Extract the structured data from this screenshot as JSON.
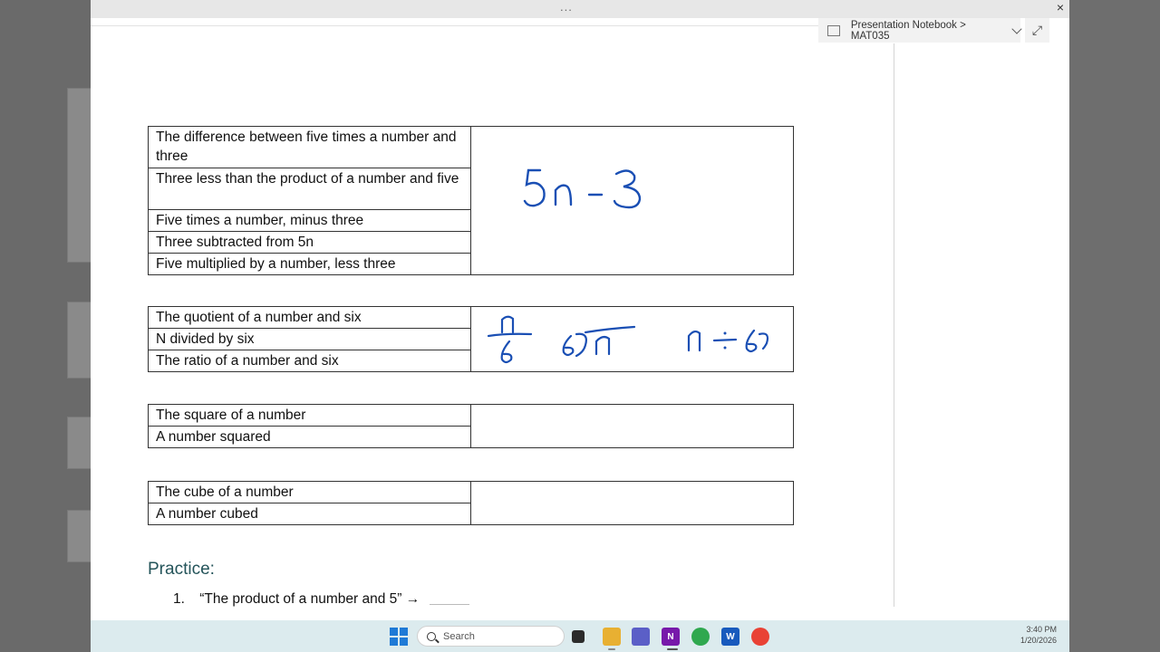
{
  "window": {
    "breadcrumb": "Presentation Notebook > MAT035",
    "dots": "...",
    "close_label": "×",
    "expand_label": "⤢"
  },
  "tables": [
    {
      "rows": [
        "The difference between five times a number and three",
        "Three less than the product of a number and five",
        "Five times a number, minus three",
        "Three subtracted from 5n",
        "Five multiplied by a number, less three"
      ],
      "ink": "5n − 3"
    },
    {
      "rows": [
        "The quotient of a number and six",
        "N divided by six",
        "The ratio of a number and six"
      ],
      "ink": "n/6   6⟌n   n ÷ 6"
    },
    {
      "rows": [
        "The square of a number",
        "A number squared"
      ],
      "ink": ""
    },
    {
      "rows": [
        "The cube of a number",
        "A number cubed"
      ],
      "ink": ""
    }
  ],
  "practice": {
    "title": "Practice:",
    "items": [
      {
        "number": "1.",
        "text": "“The product of a number and 5” →"
      }
    ]
  },
  "taskbar": {
    "search_placeholder": "Search",
    "icons": [
      "start-icon",
      "search-icon",
      "task-view-icon",
      "file-explorer-icon",
      "teams-icon",
      "onenote-icon",
      "chrome-icon",
      "word-icon",
      "chrome-profile-icon"
    ],
    "time": "3:40 PM",
    "date": "1/20/2026"
  },
  "colors": {
    "ink": "#1a4fb4",
    "practice_title": "#24545a",
    "taskbar": "#dcebee"
  }
}
